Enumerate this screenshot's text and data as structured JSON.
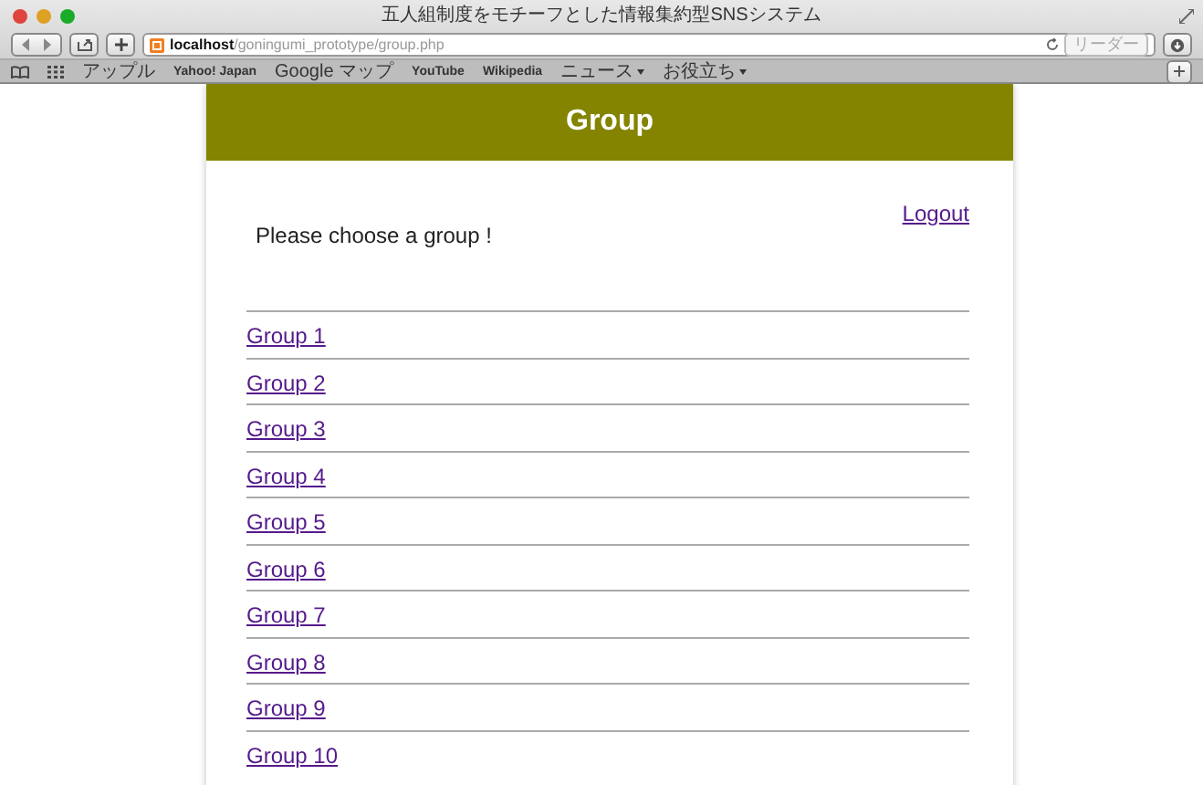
{
  "window": {
    "title": "五人組制度をモチーフとした情報集約型SNSシステム"
  },
  "toolbar": {
    "url_host": "localhost",
    "url_path": "/goningumi_prototype/group.php",
    "reader_button": "リーダー"
  },
  "bookmarks": [
    {
      "label": "アップル",
      "menu": false
    },
    {
      "label": "Yahoo! Japan",
      "menu": false
    },
    {
      "label": "Google マップ",
      "menu": false
    },
    {
      "label": "YouTube",
      "menu": false
    },
    {
      "label": "Wikipedia",
      "menu": false
    },
    {
      "label": "ニュース",
      "menu": true
    },
    {
      "label": "お役立ち",
      "menu": true
    }
  ],
  "page": {
    "header": {
      "title": "Group"
    },
    "logout": "Logout",
    "prompt": "Please choose a group !",
    "groups": [
      "Group 1",
      "Group 2",
      "Group 3",
      "Group 4",
      "Group 5",
      "Group 6",
      "Group 7",
      "Group 8",
      "Group 9",
      "Group 10"
    ]
  }
}
